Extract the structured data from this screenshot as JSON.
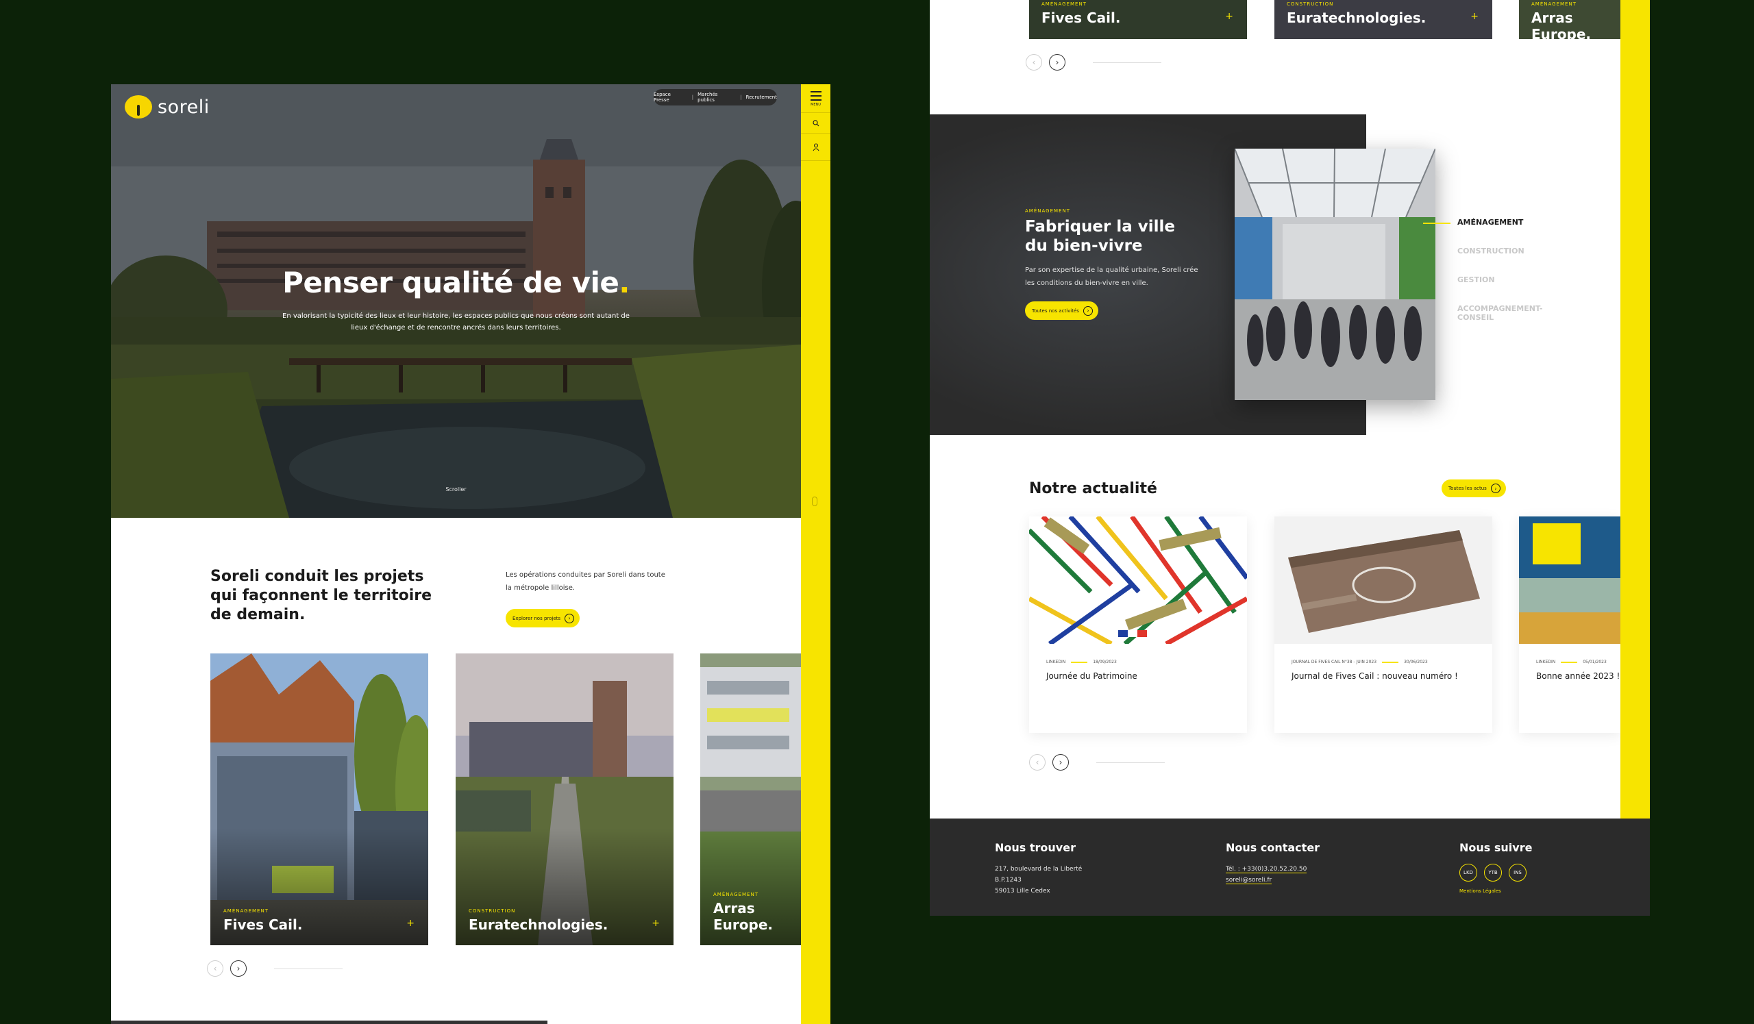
{
  "left_page": {
    "logo": "soreli",
    "top_links": [
      "Espace Presse",
      "Marchés publics",
      "Recrutement"
    ],
    "sidebar": {
      "menu_label": "MENU"
    },
    "hero": {
      "title": "Penser qualité de vie",
      "title_dot": ".",
      "subtitle": "En valorisant la typicité des lieux et leur histoire, les espaces publics que nous créons sont autant de lieux d'échange et de rencontre ancrés dans leurs territoires.",
      "scroll_label": "Scroller"
    },
    "intro": {
      "title": "Soreli conduit les projets qui façonnent le territoire de demain.",
      "text": "Les opérations conduites par Soreli dans toute la métropole lilloise.",
      "button": "Explorer nos projets"
    },
    "projects": [
      {
        "category": "AMÉNAGEMENT",
        "name": "Fives Cail."
      },
      {
        "category": "CONSTRUCTION",
        "name": "Euratechnologies."
      },
      {
        "category": "AMÉNAGEMENT",
        "name": "Arras Europe."
      }
    ]
  },
  "right_page": {
    "top_cards": [
      {
        "category": "AMÉNAGEMENT",
        "name": "Fives Cail."
      },
      {
        "category": "CONSTRUCTION",
        "name": "Euratechnologies."
      },
      {
        "category": "AMÉNAGEMENT",
        "name": "Arras Europe."
      }
    ],
    "band": {
      "category": "AMÉNAGEMENT",
      "title": "Fabriquer la ville du bien-vivre",
      "text": "Par son expertise de la qualité urbaine, Soreli crée les conditions du bien-vivre en ville.",
      "button": "Toutes nos activités"
    },
    "activity_menu": [
      "AMÉNAGEMENT",
      "CONSTRUCTION",
      "GESTION",
      "ACCOMPAGNEMENT-CONSEIL"
    ],
    "news": {
      "title": "Notre actualité",
      "button": "Toutes les actus",
      "items": [
        {
          "tag": "LINKEDIN",
          "date": "18/09/2023",
          "title": "Journée du Patrimoine"
        },
        {
          "tag": "JOURNAL DE FIVES CAIL N°38 - JUIN 2023",
          "date": "30/06/2023",
          "title": "Journal de Fives Cail : nouveau numéro !"
        },
        {
          "tag": "LINKEDIN",
          "date": "05/01/2023",
          "title": "Bonne année 2023 !"
        }
      ]
    },
    "footer": {
      "find_title": "Nous trouver",
      "address": [
        "217, boulevard de la Liberté",
        "B.P.1243",
        "59013 Lille Cedex"
      ],
      "contact_title": "Nous contacter",
      "phone": "Tél. : +33(0)3.20.52.20.50",
      "email": "soreli@soreli.fr",
      "follow_title": "Nous suivre",
      "social": [
        "LKD",
        "YTB",
        "INS"
      ],
      "legal": "Mentions Légales"
    }
  },
  "colors": {
    "background": "#0c2208",
    "accent": "#f7e400",
    "dark": "#2b2b2b"
  }
}
